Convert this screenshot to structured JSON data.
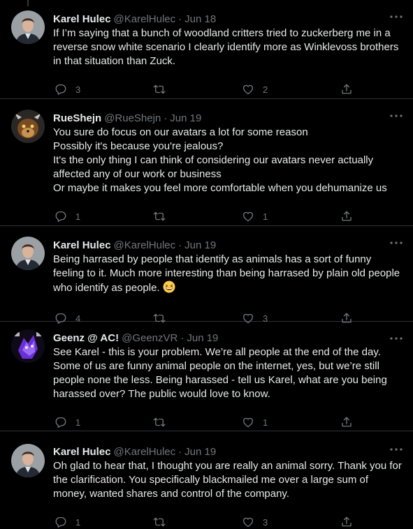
{
  "tweets": [
    {
      "name": "Karel Hulec",
      "handle": "@KarelHulec",
      "date": "Jun 18",
      "lines": [
        "If I’m saying that a bunch of woodland  critters tried to zuckerberg me in a reverse snow white scenario I clearly identify more as Winklevoss brothers in that situation than Zuck."
      ],
      "replies": "3",
      "retweets": "",
      "likes": "2"
    },
    {
      "name": "RueShejn",
      "handle": "@RueShejn",
      "date": "Jun 19",
      "lines": [
        "You sure do focus on our avatars a lot for some reason",
        "Possibly it's because you're jealous?",
        "It's the only thing I can think of considering our avatars never actually affected any of our work or business",
        "Or maybe it makes you feel more comfortable when you dehumanize us"
      ],
      "replies": "1",
      "retweets": "",
      "likes": "1"
    },
    {
      "name": "Karel Hulec",
      "handle": "@KarelHulec",
      "date": "Jun 19",
      "lines": [
        "Being harrased by people that identify as animals has a sort of funny feeling to it. Much more interesting than being harrased by plain old people who identify as people."
      ],
      "emoji": "grinning-squinting-face",
      "replies": "4",
      "retweets": "",
      "likes": "3"
    },
    {
      "name": "Geenz @ AC!",
      "handle": "@GeenzVR",
      "date": "Jun 19",
      "lines": [
        "See Karel - this is your problem.  We’re all people at the end of the day.  Some of us are funny animal people on the internet, yes, but we’re still people none the less.  Being harassed - tell us Karel, what are you being harassed over?  The public would love to know."
      ],
      "replies": "1",
      "retweets": "",
      "likes": "1"
    },
    {
      "name": "Karel Hulec",
      "handle": "@KarelHulec",
      "date": "Jun 19",
      "lines": [
        "Oh glad to hear that, I thought you are really an animal sorry. Thank you for the clarification. You specifically blackmailed me over a large sum of money, wanted shares and control of the company."
      ],
      "replies": "1",
      "retweets": "",
      "likes": "3"
    }
  ],
  "dot_separator": "·",
  "colors": {
    "background": "#000000",
    "text": "#e7e9ea",
    "secondary": "#71767b",
    "divider": "#2f3336"
  },
  "icons": [
    "reply-icon",
    "retweet-icon",
    "like-icon",
    "share-icon",
    "more-icon"
  ]
}
